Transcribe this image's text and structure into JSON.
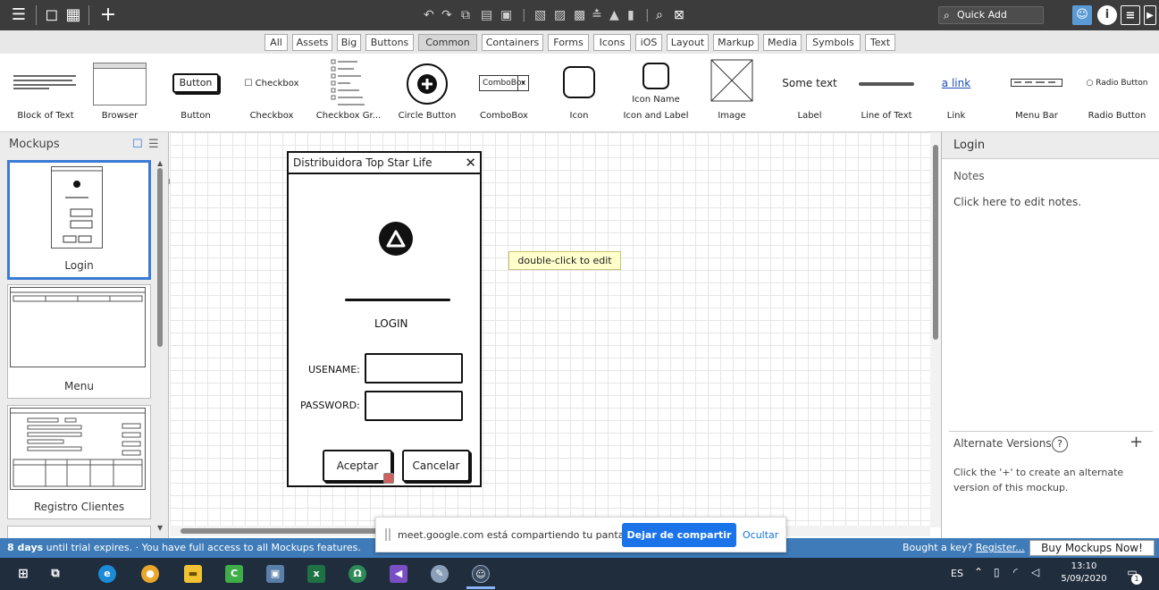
{
  "toolbar": {
    "quick_add_placeholder": "Quick Add"
  },
  "filters": [
    "All",
    "Assets",
    "Big",
    "Buttons",
    "Common",
    "Containers",
    "Forms",
    "Icons",
    "iOS",
    "Layout",
    "Markup",
    "Media",
    "Symbols",
    "Text"
  ],
  "filter_selected": "Common",
  "library": {
    "items": [
      "Block of Text",
      "Browser",
      "Button",
      "Checkbox",
      "Checkbox Gr...",
      "Circle Button",
      "ComboBox",
      "Icon",
      "Icon and Label",
      "Image",
      "Label",
      "Line of Text",
      "Link",
      "Menu Bar",
      "Radio Button"
    ],
    "button_preview": "Button",
    "checkbox_preview": "Checkbox",
    "combobox_preview": "ComboBox",
    "icon_name_preview": "Icon Name",
    "label_preview": "Some text",
    "link_preview": "a link",
    "radio_preview": "Radio Button"
  },
  "left_panel": {
    "title": "Mockups",
    "mockups": [
      "Login",
      "Menu",
      "Registro Clientes"
    ],
    "selected": "Login"
  },
  "mockup": {
    "title": "Distribuidora Top Star Life",
    "heading": "LOGIN",
    "username_label": "USENAME:",
    "password_label": "PASSWORD:",
    "accept": "Aceptar",
    "cancel": "Cancelar"
  },
  "tooltip": "double-click to edit",
  "right_panel": {
    "title": "Login",
    "notes_heading": "Notes",
    "notes_text": "Click here to edit notes.",
    "alt_heading": "Alternate Versions",
    "alt_help": "?",
    "alt_plus": "+",
    "alt_text": "Click the '+' to create an alternate version of this mockup."
  },
  "share_banner": {
    "message": "meet.google.com está compartiendo tu pantalla.",
    "stop": "Dejar de compartir",
    "hide": "Ocultar"
  },
  "trial_bar": {
    "days": "8 days",
    "message": " until trial expires. · You have full access to all Mockups features.",
    "bought": "Bought a key?",
    "register": "Register...",
    "buy": "Buy Mockups Now!"
  },
  "taskbar": {
    "lang": "ES",
    "time": "13:10",
    "date": "5/09/2020",
    "notifications": "1"
  }
}
